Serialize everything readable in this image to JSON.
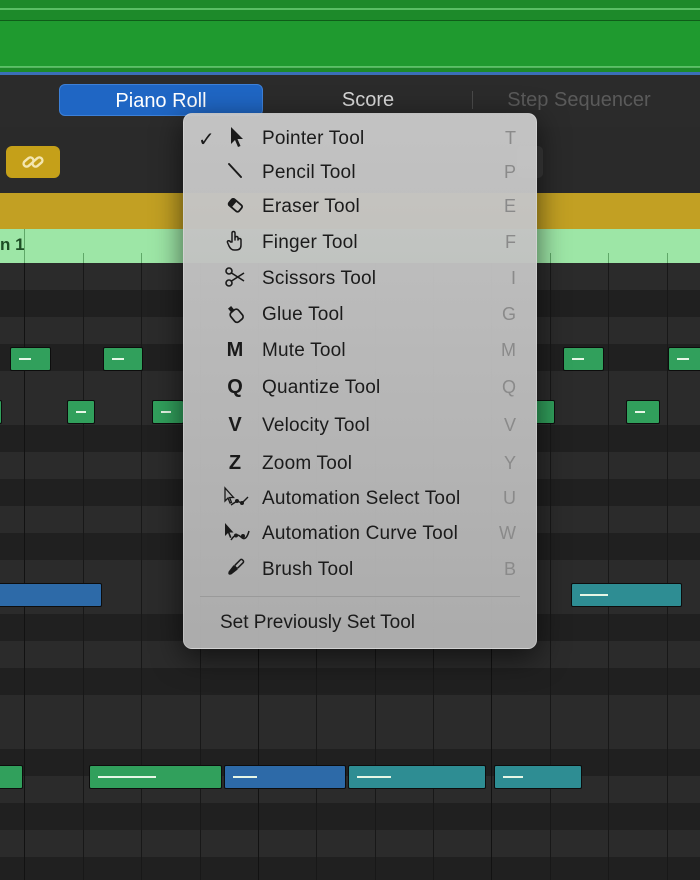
{
  "tabs": [
    {
      "label": "Piano Roll",
      "active": true
    },
    {
      "label": "Score",
      "active": false
    },
    {
      "label": "Step Sequencer",
      "active": false
    }
  ],
  "toolbar": {
    "link_icon": "link-icon",
    "link_color": "#c5a019"
  },
  "ruler": {
    "bar_label": "n 1"
  },
  "colors": {
    "region_green": "#1f9a2f",
    "region_header_gold": "#c2a023",
    "ruler_green": "#9de6a6",
    "active_tab_blue": "#1f66c4",
    "note_green": "#31a05c",
    "note_teal": "#2e8d93",
    "note_blue": "#2d6aa8"
  },
  "menu": {
    "items": [
      {
        "label": "Pointer Tool",
        "key": "T",
        "icon": "pointer-icon",
        "checked": true
      },
      {
        "label": "Pencil Tool",
        "key": "P",
        "icon": "pencil-icon",
        "checked": false
      },
      {
        "label": "Eraser Tool",
        "key": "E",
        "icon": "eraser-icon",
        "checked": false
      },
      {
        "label": "Finger Tool",
        "key": "F",
        "icon": "finger-icon",
        "checked": false
      },
      {
        "label": "Scissors Tool",
        "key": "I",
        "icon": "scissors-icon",
        "checked": false
      },
      {
        "label": "Glue Tool",
        "key": "G",
        "icon": "glue-icon",
        "checked": false
      },
      {
        "label": "Mute Tool",
        "key": "M",
        "icon": "M",
        "checked": false
      },
      {
        "label": "Quantize Tool",
        "key": "Q",
        "icon": "Q",
        "checked": false
      },
      {
        "label": "Velocity Tool",
        "key": "V",
        "icon": "V",
        "checked": false
      },
      {
        "label": "Zoom Tool",
        "key": "Y",
        "icon": "Z",
        "checked": false
      },
      {
        "label": "Automation Select Tool",
        "key": "U",
        "icon": "automation-select-icon",
        "checked": false
      },
      {
        "label": "Automation Curve Tool",
        "key": "W",
        "icon": "automation-curve-icon",
        "checked": false
      },
      {
        "label": "Brush Tool",
        "key": "B",
        "icon": "brush-icon",
        "checked": false
      }
    ],
    "check_mark": "✓",
    "set_previous": "Set Previously Set Tool"
  }
}
